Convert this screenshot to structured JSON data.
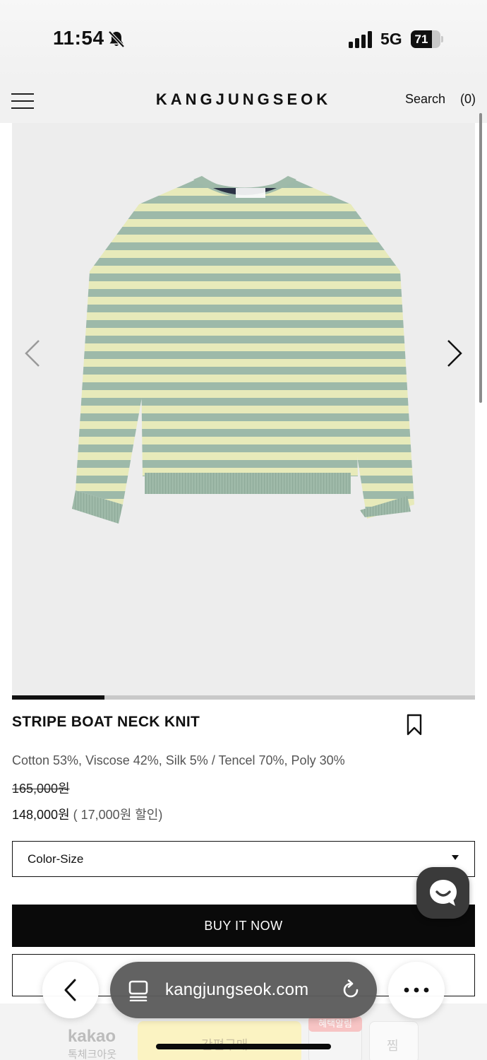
{
  "status_bar": {
    "time": "11:54",
    "network": "5G",
    "battery_level": "71",
    "battery_fraction": 0.71,
    "icons": [
      "bell-slash-icon",
      "signal-icon",
      "battery-icon"
    ]
  },
  "header": {
    "brand": "KANGJUNGSEOK",
    "search_label": "Search",
    "cart_count": "(0)",
    "icons": [
      "menu-icon"
    ]
  },
  "gallery": {
    "image_subject": "green-yellow striped knit sweater",
    "stripe_colors": [
      "#9db9a9",
      "#e7eaba"
    ],
    "background": "#ededed",
    "slide_progress": 0.2,
    "icons": [
      "chevron-left-icon",
      "chevron-right-icon"
    ]
  },
  "product": {
    "title": "STRIPE BOAT NECK KNIT",
    "material": "Cotton 53%, Viscose 42%, Silk 5% / Tencel 70%, Poly 30%",
    "price_original": "165,000원",
    "price_sale": "148,000원",
    "price_discount": " ( 17,000원 할인)"
  },
  "options": {
    "select_value": "Color-Size"
  },
  "actions": {
    "buy_now": "BUY IT NOW"
  },
  "checkout_strip": {
    "kakao_logo": "kakao",
    "kakao_sub": "톡체크아웃",
    "easy_pay": "간편구매",
    "benefit_badge": "혜택알림",
    "wish": "찜"
  },
  "browser": {
    "url": "kangjungseok.com",
    "icons": [
      "back-icon",
      "tabs-icon",
      "reload-icon",
      "more-icon"
    ]
  },
  "colors": {
    "accent": "#0a0a0a",
    "chat_button": "#3a3a3a"
  }
}
